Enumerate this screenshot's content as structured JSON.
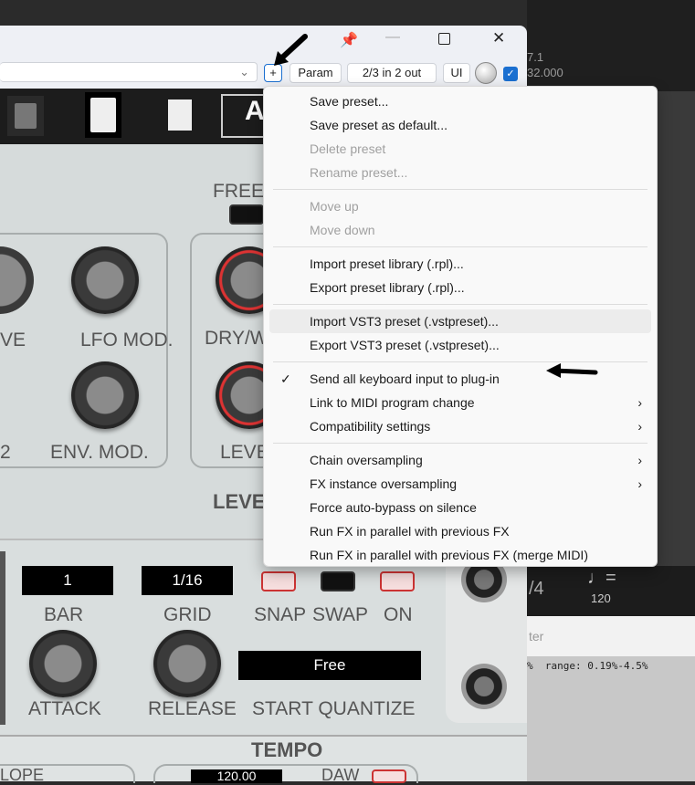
{
  "daw": {
    "ruler_a": "7.1",
    "ruler_b": "32.000",
    "time_sig": "/4",
    "tempo": "120",
    "filter_partial": "ter",
    "range_text": "%  range: 0.19%-4.5%"
  },
  "window": {
    "title_buttons": {
      "pin": "pin-icon",
      "minimize": "—",
      "maximize": "☐",
      "close": "✕"
    },
    "toolbar": {
      "preset_value": "",
      "add_label": "+",
      "param_label": "Param",
      "io_label": "2/3 in 2 out",
      "ui_label": "UI"
    }
  },
  "plugin": {
    "toolbar_partial": "A",
    "labels": {
      "freeze": "FREEZ",
      "ve": "VE",
      "lfo_mod": "LFO MOD.",
      "dry_wet": "DRY/W",
      "two": "2",
      "env_mod": "ENV. MOD.",
      "level_knob": "LEVE",
      "level_section": "LEVE",
      "bar": "BAR",
      "grid": "GRID",
      "snap": "SNAP",
      "swap": "SWAP",
      "on": "ON",
      "attack": "ATTACK",
      "release": "RELEASE",
      "start_quantize": "START QUANTIZE",
      "tempo": "TEMPO",
      "slope": "LOPE",
      "daw": "DAW"
    },
    "displays": {
      "bar": "1",
      "grid": "1/16",
      "start_quantize": "Free",
      "tempo": "120.00"
    }
  },
  "menu": {
    "groups": [
      [
        {
          "label": "Save preset...",
          "enabled": true
        },
        {
          "label": "Save preset as default...",
          "enabled": true
        },
        {
          "label": "Delete preset",
          "enabled": false
        },
        {
          "label": "Rename preset...",
          "enabled": false
        }
      ],
      [
        {
          "label": "Move up",
          "enabled": false
        },
        {
          "label": "Move down",
          "enabled": false
        }
      ],
      [
        {
          "label": "Import preset library (.rpl)...",
          "enabled": true
        },
        {
          "label": "Export preset library (.rpl)...",
          "enabled": true
        }
      ],
      [
        {
          "label": "Import VST3 preset (.vstpreset)...",
          "enabled": true,
          "highlighted": true
        },
        {
          "label": "Export VST3 preset (.vstpreset)...",
          "enabled": true
        }
      ],
      [
        {
          "label": "Send all keyboard input to plug-in",
          "enabled": true,
          "checked": true,
          "check": "✓"
        },
        {
          "label": "Link to MIDI program change",
          "enabled": true,
          "submenu": "›"
        },
        {
          "label": "Compatibility settings",
          "enabled": true,
          "submenu": "›"
        }
      ],
      [
        {
          "label": "Chain oversampling",
          "enabled": true,
          "submenu": "›"
        },
        {
          "label": "FX instance oversampling",
          "enabled": true,
          "submenu": "›"
        },
        {
          "label": "Force auto-bypass on silence",
          "enabled": true
        },
        {
          "label": "Run FX in parallel with previous FX",
          "enabled": true
        },
        {
          "label": "Run FX in parallel with previous FX (merge MIDI)",
          "enabled": true
        }
      ]
    ]
  }
}
